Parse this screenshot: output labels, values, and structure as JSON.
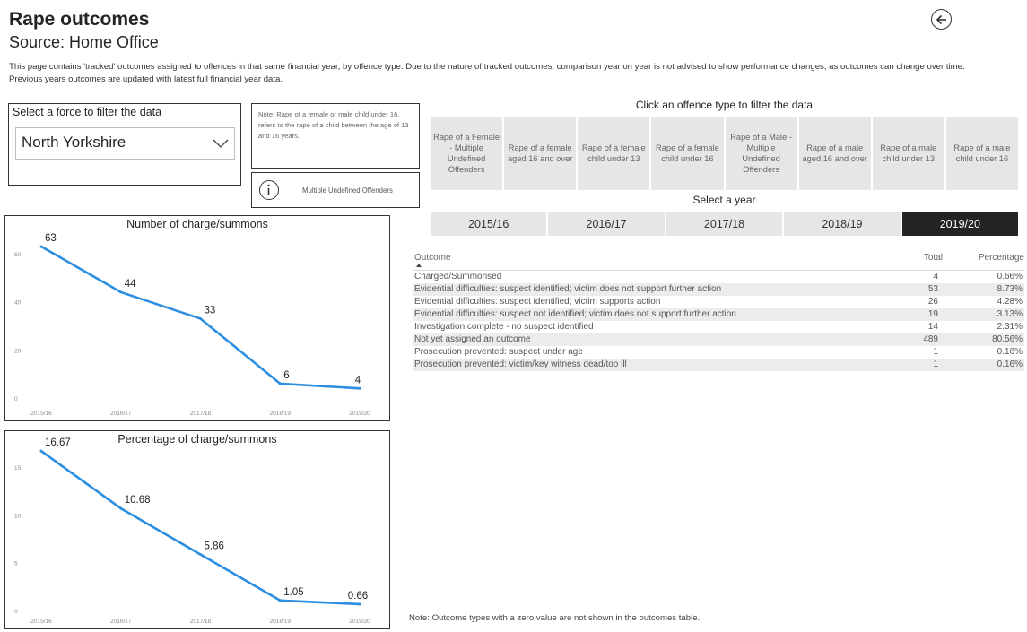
{
  "header": {
    "title": "Rape outcomes",
    "subtitle": "Source: Home Office",
    "description": "This page contains 'tracked' outcomes assigned to offences in that same financial year, by offence type. Due to the nature of tracked outcomes, comparison year on year is not advised to show performance changes, as outcomes can change over time. Previous years outcomes are updated with latest full financial year data.",
    "back_icon": "arrow-left-circle-icon"
  },
  "force_filter": {
    "label": "Select a force to filter the data",
    "value": "North Yorkshire",
    "chevron_icon": "chevron-down-icon"
  },
  "note": "Note: Rape of a female or male child under 16, refers to the rape of a child between the age of 13 and 16 years.",
  "info": {
    "icon": "info-icon",
    "text": "Multiple Undefined Offenders"
  },
  "offence_types": {
    "heading": "Click an offence type to filter the data",
    "items": [
      "Rape of a Female - Multiple Undefined Offenders",
      "Rape of a female aged 16 and over",
      "Rape of a female child under 13",
      "Rape of a female child under 16",
      "Rape of a Male - Multiple Undefined Offenders",
      "Rape of a male aged 16 and over",
      "Rape of a male child under 13",
      "Rape of a male child under 16"
    ]
  },
  "years": {
    "heading": "Select a year",
    "items": [
      "2015/16",
      "2016/17",
      "2017/18",
      "2018/19",
      "2019/20"
    ],
    "selected": "2019/20"
  },
  "outcomes_table": {
    "columns": [
      "Outcome",
      "Total",
      "Percentage"
    ],
    "rows": [
      {
        "outcome": "Charged/Summonsed",
        "total": "4",
        "percentage": "0.66%"
      },
      {
        "outcome": "Evidential difficulties: suspect identified; victim does not support further action",
        "total": "53",
        "percentage": "8.73%"
      },
      {
        "outcome": "Evidential difficulties: suspect identified; victim supports action",
        "total": "26",
        "percentage": "4.28%"
      },
      {
        "outcome": "Evidential difficulties: suspect not identified; victim does not support further action",
        "total": "19",
        "percentage": "3.13%"
      },
      {
        "outcome": "Investigation complete - no suspect identified",
        "total": "14",
        "percentage": "2.31%"
      },
      {
        "outcome": "Not yet assigned an outcome",
        "total": "489",
        "percentage": "80.56%"
      },
      {
        "outcome": "Prosecution prevented: suspect under age",
        "total": "1",
        "percentage": "0.16%"
      },
      {
        "outcome": "Prosecution prevented: victim/key witness dead/too ill",
        "total": "1",
        "percentage": "0.16%"
      }
    ]
  },
  "footnote": "Note: Outcome types with a zero value are not shown in the outcomes table.",
  "colors": {
    "line": "#2b8ee0",
    "selected_year_bg": "#252423",
    "button_bg": "#e6e6e6"
  },
  "chart_data": [
    {
      "type": "line",
      "title": "Number of charge/summons",
      "x": [
        "2015/16",
        "2016/17",
        "2017/18",
        "2018/19",
        "2019/20"
      ],
      "values": [
        63,
        44,
        33,
        6,
        4
      ],
      "data_labels": [
        "63",
        "44",
        "33",
        "6",
        "4"
      ],
      "ylim": [
        0,
        60
      ],
      "yticks": [
        0,
        20,
        40,
        60
      ],
      "grid": false,
      "legend": "none"
    },
    {
      "type": "line",
      "title": "Percentage of charge/summons",
      "x": [
        "2015/16",
        "2016/17",
        "2017/18",
        "2018/19",
        "2019/20"
      ],
      "values": [
        16.67,
        10.68,
        5.86,
        1.05,
        0.66
      ],
      "data_labels": [
        "16.67",
        "10.68",
        "5.86",
        "1.05",
        "0.66"
      ],
      "ylim": [
        0,
        15
      ],
      "yticks": [
        0,
        5,
        10,
        15
      ],
      "grid": false,
      "legend": "none"
    }
  ]
}
